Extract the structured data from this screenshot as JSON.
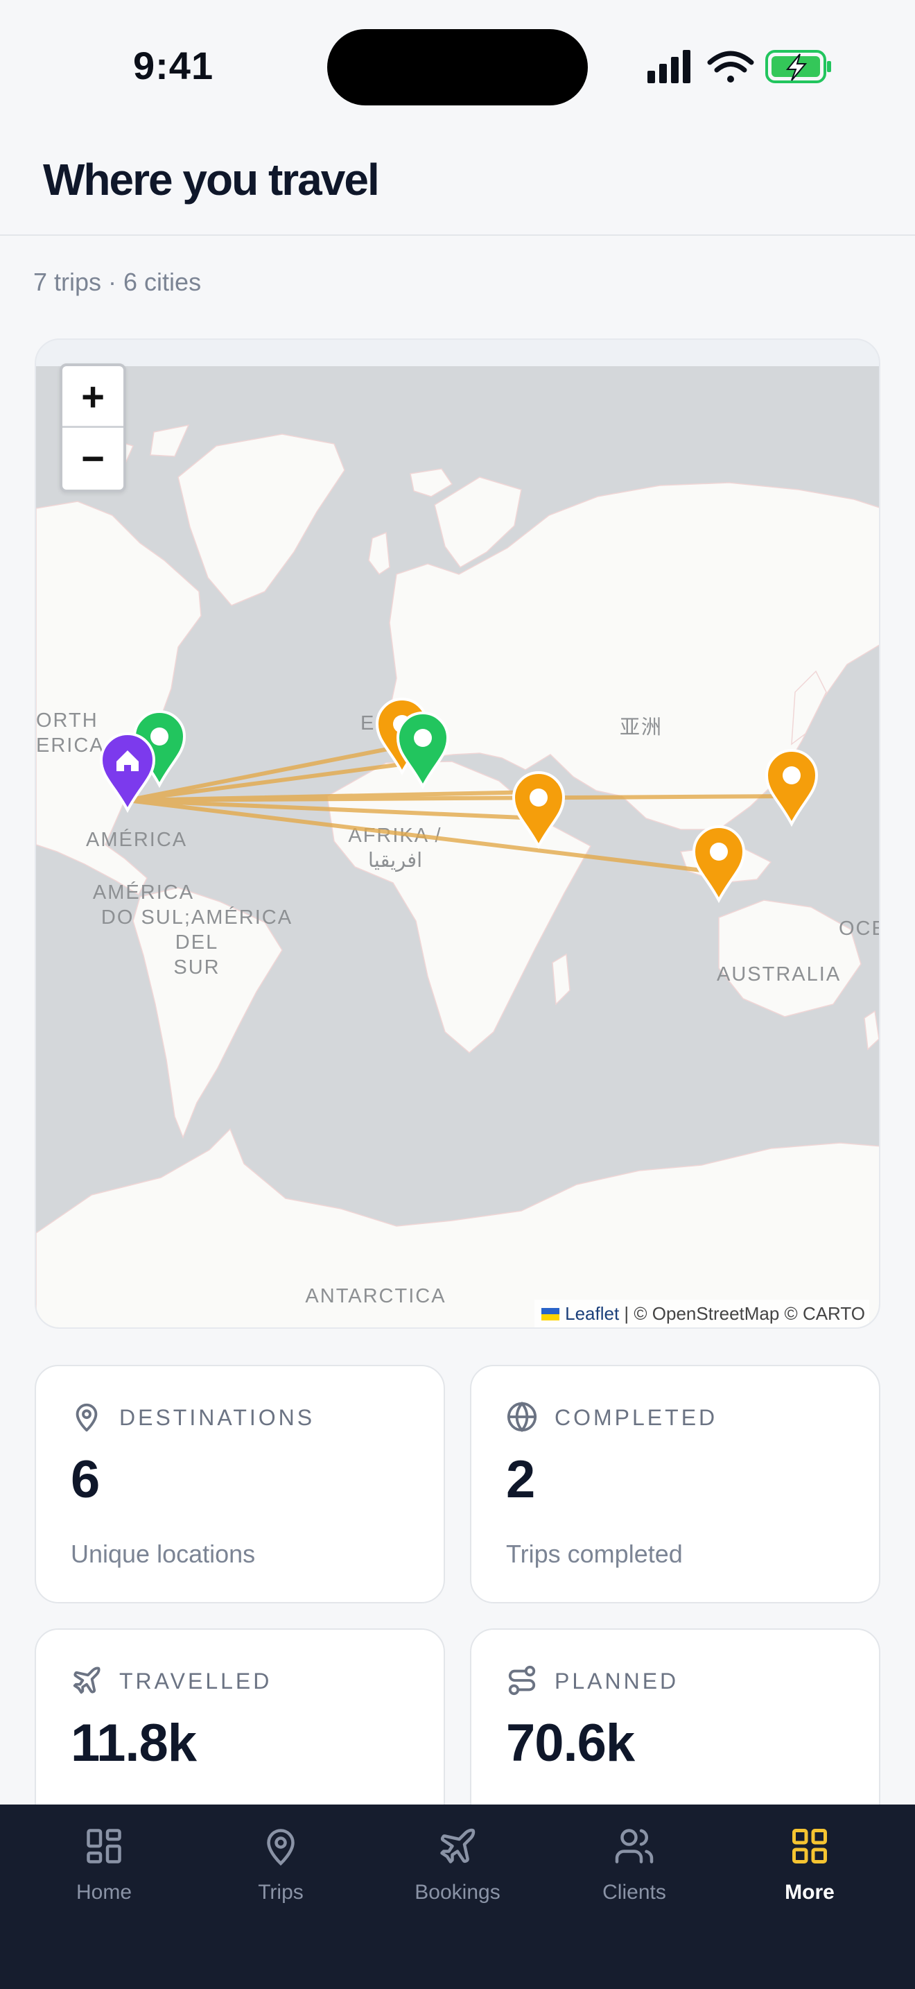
{
  "status": {
    "time": "9:41"
  },
  "header": {
    "title": "Where you travel"
  },
  "summary": {
    "text": "7 trips · 6 cities"
  },
  "map": {
    "zoom_in": "+",
    "zoom_out": "−",
    "labels": {
      "north_america_1": "ORTH",
      "north_america_2": "ERICA",
      "europe": "EU  PE",
      "asia": "亚洲",
      "america": "AMÉRICA",
      "south_america_1": "AMÉRICA",
      "south_america_2": "DO SUL;AMÉRICA",
      "south_america_3": "DEL",
      "south_america_4": "SUR",
      "africa_1": "AFRIKA /",
      "africa_2": "افريقيا",
      "australia": "AUSTRALIA",
      "oceania": "OCE",
      "antarctica": "ANTARCTICA"
    },
    "attribution": {
      "leaflet": "Leaflet",
      "rest": " | © OpenStreetMap © CARTO"
    },
    "colors": {
      "home": "#7c3aed",
      "completed": "#22c55e",
      "planned": "#f59e0b",
      "route": "#e3a94b"
    }
  },
  "stats": [
    {
      "label": "DESTINATIONS",
      "value": "6",
      "desc": "Unique locations",
      "icon": "map-pin-icon"
    },
    {
      "label": "COMPLETED",
      "value": "2",
      "desc": "Trips completed",
      "icon": "globe-icon"
    },
    {
      "label": "TRAVELLED",
      "value": "11.8k",
      "desc": "",
      "icon": "plane-icon"
    },
    {
      "label": "PLANNED",
      "value": "70.6k",
      "desc": "",
      "icon": "route-icon"
    }
  ],
  "tabs": [
    {
      "label": "Home",
      "icon": "grid-icon"
    },
    {
      "label": "Trips",
      "icon": "map-pin-icon"
    },
    {
      "label": "Bookings",
      "icon": "plane-icon"
    },
    {
      "label": "Clients",
      "icon": "users-icon"
    },
    {
      "label": "More",
      "icon": "grid-icon",
      "active": true
    }
  ],
  "colors": {
    "accent": "#f5c431",
    "tabbar_bg": "#161d2e",
    "text": "#0f172a",
    "muted": "#7b8494"
  }
}
